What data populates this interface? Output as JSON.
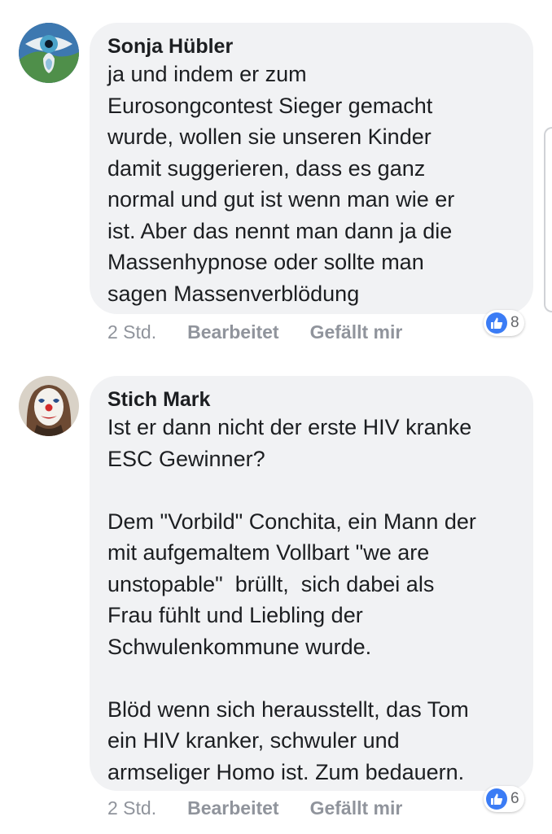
{
  "comments": [
    {
      "author": "Sonja Hübler",
      "text": "ja und indem er zum\nEurosongcontest Sieger gemacht\nwurde, wollen sie unseren Kinder\ndamit suggerieren, dass es ganz\nnormal und gut ist wenn man wie er\nist. Aber das nennt man dann ja die\nMassenhypnose oder sollte man\nsagen Massenverblödung",
      "time": "2 Std.",
      "edited_label": "Bearbeitet",
      "like_label": "Gefällt mir",
      "reaction_count": "8",
      "avatar_icon": "eye-earth-avatar-icon"
    },
    {
      "author": "Stich Mark",
      "text": "Ist er dann nicht der erste HIV kranke\nESC Gewinner?\n\nDem \"Vorbild\" Conchita, ein Mann der\nmit aufgemaltem Vollbart \"we are\nunstopable\"  brüllt,  sich dabei als\nFrau fühlt und Liebling der\nSchwulenkommune wurde.\n\nBlöd wenn sich herausstellt, das Tom\nein HIV kranker, schwuler und\narmseliger Homo ist. Zum bedauern.",
      "time": "2 Std.",
      "edited_label": "Bearbeitet",
      "like_label": "Gefällt mir",
      "reaction_count": "6",
      "avatar_icon": "clown-avatar-icon"
    }
  ],
  "colors": {
    "bubble": "#f1f2f4",
    "meta_text": "#90949c",
    "like_blue": "#3b7cf5"
  }
}
